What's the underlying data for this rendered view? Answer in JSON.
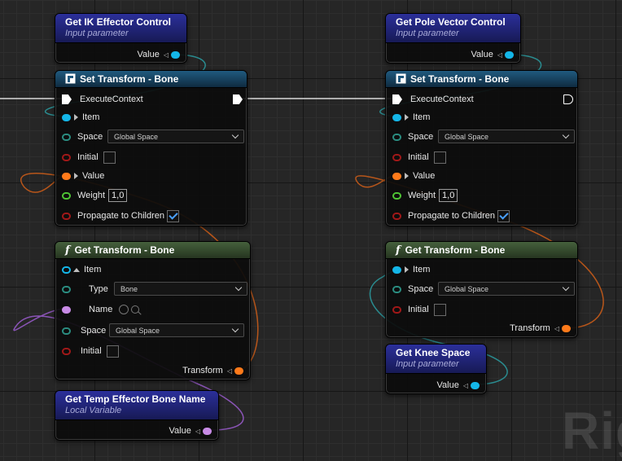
{
  "colors": {
    "transform_pin": "#ff7a1a",
    "blue_pin": "#14b6e8",
    "teal_pin": "#2a8c80",
    "red_pin": "#a01818",
    "green_pin": "#4ec334",
    "name_pin": "#c88be6"
  },
  "watermark": "Rig",
  "nodes": {
    "ik_control": {
      "title": "Get IK Effector Control",
      "subtitle": "Input parameter",
      "out_label": "Value"
    },
    "pole_control": {
      "title": "Get Pole Vector Control",
      "subtitle": "Input parameter",
      "out_label": "Value"
    },
    "set_left": {
      "title": "Set Transform - Bone",
      "exec_label": "ExecuteContext",
      "item_label": "Item",
      "space_label": "Space",
      "space_value": "Global Space",
      "initial_label": "Initial",
      "value_label": "Value",
      "weight_label": "Weight",
      "weight_value": "1,0",
      "propagate_label": "Propagate to Children"
    },
    "set_right": {
      "title": "Set Transform - Bone",
      "exec_label": "ExecuteContext",
      "item_label": "Item",
      "space_label": "Space",
      "space_value": "Global Space",
      "initial_label": "Initial",
      "value_label": "Value",
      "weight_label": "Weight",
      "weight_value": "1,0",
      "propagate_label": "Propagate to Children"
    },
    "get_left": {
      "title": "Get Transform - Bone",
      "item_label": "Item",
      "type_label": "Type",
      "type_value": "Bone",
      "name_label": "Name",
      "space_label": "Space",
      "space_value": "Global Space",
      "initial_label": "Initial",
      "out_label": "Transform"
    },
    "get_right": {
      "title": "Get Transform - Bone",
      "item_label": "Item",
      "space_label": "Space",
      "space_value": "Global Space",
      "initial_label": "Initial",
      "out_label": "Transform"
    },
    "knee_space": {
      "title": "Get Knee Space",
      "subtitle": "Input parameter",
      "out_label": "Value"
    },
    "temp_bone": {
      "title": "Get Temp Effector Bone Name",
      "subtitle": "Local Variable",
      "out_label": "Value"
    }
  }
}
